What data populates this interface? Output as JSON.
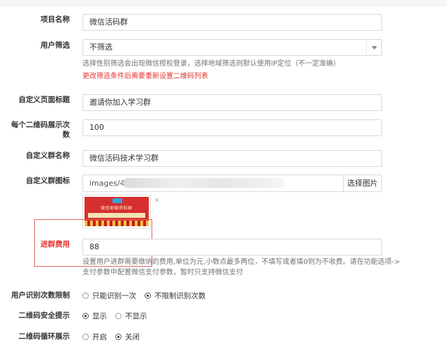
{
  "form": {
    "project_name": {
      "label": "项目名称",
      "value": "微信活码群"
    },
    "user_filter": {
      "label": "用户筛选",
      "value": "不筛选",
      "help": "选择性别筛选会出现微信授权登录，选择地域筛选则默认使用IP定位（不一定准确）",
      "warning": "更改筛选条件后需要重新设置二维码列表"
    },
    "page_title": {
      "label": "自定义页面标题",
      "value": "邀请你加入学习群"
    },
    "display_count": {
      "label_line1": "每个二维码展示次",
      "label_line2": "数",
      "value": "100"
    },
    "group_name": {
      "label": "自定义群名称",
      "value": "微信活码技术学习群"
    },
    "group_icon": {
      "label": "自定义群图标",
      "path_value": "images/4",
      "button": "选择图片",
      "close": "×",
      "thumb_title": "微信群聊资料群",
      "thumb_subtitle": "让你加入群不受100人限制"
    },
    "group_fee": {
      "label": "进群费用",
      "value": "88",
      "help_line1": "设置用户进群需要缴纳的费用,单位为元,小数点最多两位，不填写或者填0则为不收费。请在功能选项->",
      "help_line2": "支付参数中配置微信支付参数，暂时只支持微信支付"
    },
    "identify_limit": {
      "label": "用户识别次数限制",
      "options": [
        "只能识别一次",
        "不限制识别次数"
      ],
      "selected": 1
    },
    "qr_safety": {
      "label": "二维码安全提示",
      "options": [
        "显示",
        "不显示"
      ],
      "selected": 0
    },
    "qr_loop": {
      "label": "二维码循环展示",
      "options": [
        "开启",
        "关闭"
      ],
      "selected": 1
    }
  },
  "colors": {
    "warning": "#e5322d",
    "highlight_border": "#e06464"
  }
}
